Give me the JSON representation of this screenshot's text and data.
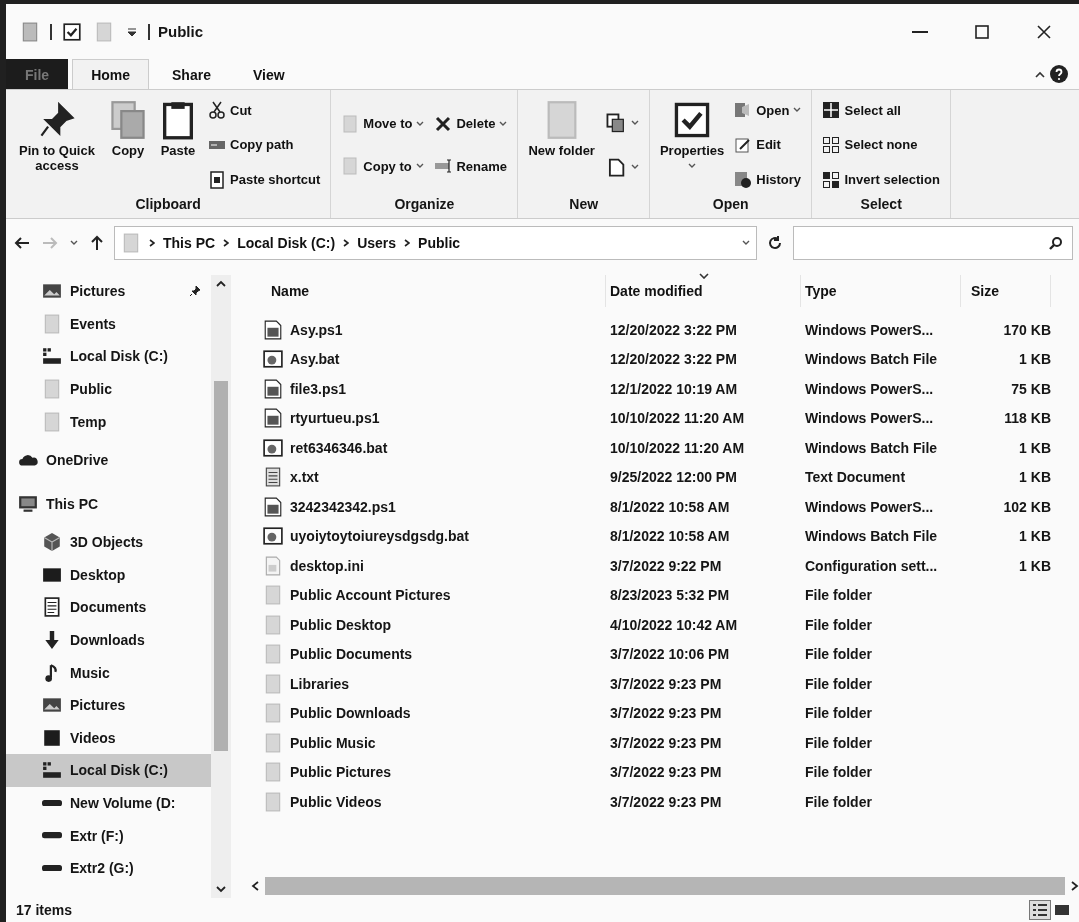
{
  "window": {
    "title": "Public"
  },
  "tabs": [
    {
      "label": "File",
      "kind": "file",
      "selected": false
    },
    {
      "label": "Home",
      "kind": "tab",
      "selected": true
    },
    {
      "label": "Share",
      "kind": "tab",
      "selected": false
    },
    {
      "label": "View",
      "kind": "tab",
      "selected": false
    }
  ],
  "ribbon": [
    {
      "label": "Clipboard",
      "large": [
        {
          "label": "Pin to Quick access",
          "kind": "pin"
        },
        {
          "label": "Copy",
          "kind": "copy"
        },
        {
          "label": "Paste",
          "kind": "paste"
        }
      ],
      "small": [
        [
          {
            "label": "Cut",
            "kind": "scissors"
          },
          {
            "label": "Copy path",
            "kind": "path"
          },
          {
            "label": "Paste shortcut",
            "kind": "shortcut"
          }
        ]
      ]
    },
    {
      "label": "Organize",
      "small": [
        [
          {
            "label": "Move to",
            "kind": "folder",
            "dropdown": true
          },
          {
            "label": "Copy to",
            "kind": "folder",
            "dropdown": true
          }
        ],
        [
          {
            "label": "Delete",
            "kind": "delete",
            "dropdown": true
          },
          {
            "label": "Rename",
            "kind": "rename",
            "dropdown": false
          }
        ]
      ]
    },
    {
      "label": "New",
      "large": [
        {
          "label": "New folder",
          "kind": "folder"
        }
      ],
      "small": [
        [
          {
            "kind": "newitem",
            "dropdown": true
          },
          {
            "kind": "easy",
            "dropdown": true
          }
        ]
      ]
    },
    {
      "label": "Open",
      "large": [
        {
          "label": "Properties",
          "kind": "check",
          "dropdown": true
        }
      ],
      "small": [
        [
          {
            "label": "Open",
            "kind": "open",
            "dropdown": true
          },
          {
            "label": "Edit",
            "kind": "edit",
            "dropdown": false
          },
          {
            "label": "History",
            "kind": "history",
            "dropdown": false
          }
        ]
      ]
    },
    {
      "label": "Select",
      "small": [
        [
          {
            "label": "Select all",
            "kind": "selall"
          },
          {
            "label": "Select none",
            "kind": "selnone"
          },
          {
            "label": "Invert selection",
            "kind": "selinv"
          }
        ]
      ]
    }
  ],
  "address_bar": {
    "path": [
      "This PC",
      "Local Disk (C:)",
      "Users",
      "Public"
    ]
  },
  "sidebar": {
    "quick_access_items": [
      {
        "label": "Pictures",
        "kind": "picture",
        "pinned": true,
        "selected": false
      },
      {
        "label": "Events",
        "kind": "folder",
        "pinned": false,
        "selected": false
      },
      {
        "label": "Local Disk (C:)",
        "kind": "drive",
        "pinned": false,
        "selected": false
      },
      {
        "label": "Public",
        "kind": "folder",
        "pinned": false,
        "selected": false
      },
      {
        "label": "Temp",
        "kind": "folder",
        "pinned": false,
        "selected": false
      }
    ],
    "items": [
      {
        "label": "OneDrive",
        "kind": "cloud",
        "selected": false
      },
      {
        "label": "This PC",
        "kind": "pc",
        "selected": false,
        "children": [
          {
            "label": "3D Objects",
            "kind": "cube",
            "selected": false
          },
          {
            "label": "Desktop",
            "kind": "desktop",
            "selected": false
          },
          {
            "label": "Documents",
            "kind": "document",
            "selected": false
          },
          {
            "label": "Downloads",
            "kind": "download",
            "selected": false
          },
          {
            "label": "Music",
            "kind": "music",
            "selected": false
          },
          {
            "label": "Pictures",
            "kind": "picture",
            "selected": false
          },
          {
            "label": "Videos",
            "kind": "video",
            "selected": false
          },
          {
            "label": "Local Disk (C:)",
            "kind": "drive",
            "selected": true
          },
          {
            "label": "New Volume (D:",
            "kind": "volume",
            "selected": false
          },
          {
            "label": "Extr (F:)",
            "kind": "volume",
            "selected": false
          },
          {
            "label": "Extr2 (G:)",
            "kind": "volume",
            "selected": false
          }
        ]
      }
    ]
  },
  "table": {
    "columns": [
      {
        "label": "Name",
        "sorted": false
      },
      {
        "label": "Date modified",
        "sorted": true
      },
      {
        "label": "Type",
        "sorted": false
      },
      {
        "label": "Size",
        "sorted": false
      }
    ],
    "rows": [
      {
        "name": "Asy.ps1",
        "kind": "script",
        "date": "12/20/2022 3:22 PM",
        "type": "Windows PowerS...",
        "size": "170 KB"
      },
      {
        "name": "Asy.bat",
        "kind": "batch",
        "date": "12/20/2022 3:22 PM",
        "type": "Windows Batch File",
        "size": "1 KB"
      },
      {
        "name": "file3.ps1",
        "kind": "script",
        "date": "12/1/2022 10:19 AM",
        "type": "Windows PowerS...",
        "size": "75 KB"
      },
      {
        "name": "rtyurtueu.ps1",
        "kind": "script",
        "date": "10/10/2022 11:20 AM",
        "type": "Windows PowerS...",
        "size": "118 KB"
      },
      {
        "name": "ret6346346.bat",
        "kind": "batch",
        "date": "10/10/2022 11:20 AM",
        "type": "Windows Batch File",
        "size": "1 KB"
      },
      {
        "name": "x.txt",
        "kind": "text",
        "date": "9/25/2022 12:00 PM",
        "type": "Text Document",
        "size": "1 KB"
      },
      {
        "name": "3242342342.ps1",
        "kind": "script",
        "date": "8/1/2022 10:58 AM",
        "type": "Windows PowerS...",
        "size": "102 KB"
      },
      {
        "name": "uyoiytoytoiureysdgsdg.bat",
        "kind": "batch",
        "date": "8/1/2022 10:58 AM",
        "type": "Windows Batch File",
        "size": "1 KB"
      },
      {
        "name": "desktop.ini",
        "kind": "settings",
        "date": "3/7/2022 9:22 PM",
        "type": "Configuration sett...",
        "size": "1 KB"
      },
      {
        "name": "Public Account Pictures",
        "kind": "folder",
        "date": "8/23/2023 5:32 PM",
        "type": "File folder"
      },
      {
        "name": "Public Desktop",
        "kind": "folder",
        "date": "4/10/2022 10:42 AM",
        "type": "File folder"
      },
      {
        "name": "Public Documents",
        "kind": "folder",
        "date": "3/7/2022 10:06 PM",
        "type": "File folder"
      },
      {
        "name": "Libraries",
        "kind": "folder",
        "date": "3/7/2022 9:23 PM",
        "type": "File folder"
      },
      {
        "name": "Public Downloads",
        "kind": "folder",
        "date": "3/7/2022 9:23 PM",
        "type": "File folder"
      },
      {
        "name": "Public Music",
        "kind": "folder",
        "date": "3/7/2022 9:23 PM",
        "type": "File folder"
      },
      {
        "name": "Public Pictures",
        "kind": "folder",
        "date": "3/7/2022 9:23 PM",
        "type": "File folder"
      },
      {
        "name": "Public Videos",
        "kind": "folder",
        "date": "3/7/2022 9:23 PM",
        "type": "File folder"
      }
    ]
  },
  "status_bar": {
    "item_count": "17 items",
    "views": [
      {
        "kind": "details",
        "selected": true
      },
      {
        "kind": "large",
        "selected": false
      }
    ]
  }
}
